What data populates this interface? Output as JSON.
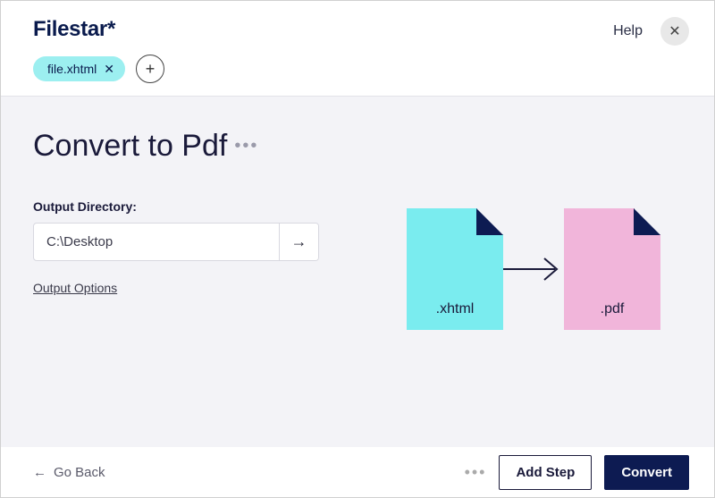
{
  "header": {
    "app_title": "Filestar*",
    "help_label": "Help",
    "file_chip": {
      "name": "file.xhtml"
    }
  },
  "main": {
    "page_title": "Convert to Pdf",
    "output_dir_label": "Output Directory:",
    "output_dir_value": "C:\\Desktop",
    "output_options_label": "Output Options",
    "source_ext": ".xhtml",
    "target_ext": ".pdf"
  },
  "footer": {
    "go_back_label": "Go Back",
    "add_step_label": "Add Step",
    "convert_label": "Convert"
  }
}
